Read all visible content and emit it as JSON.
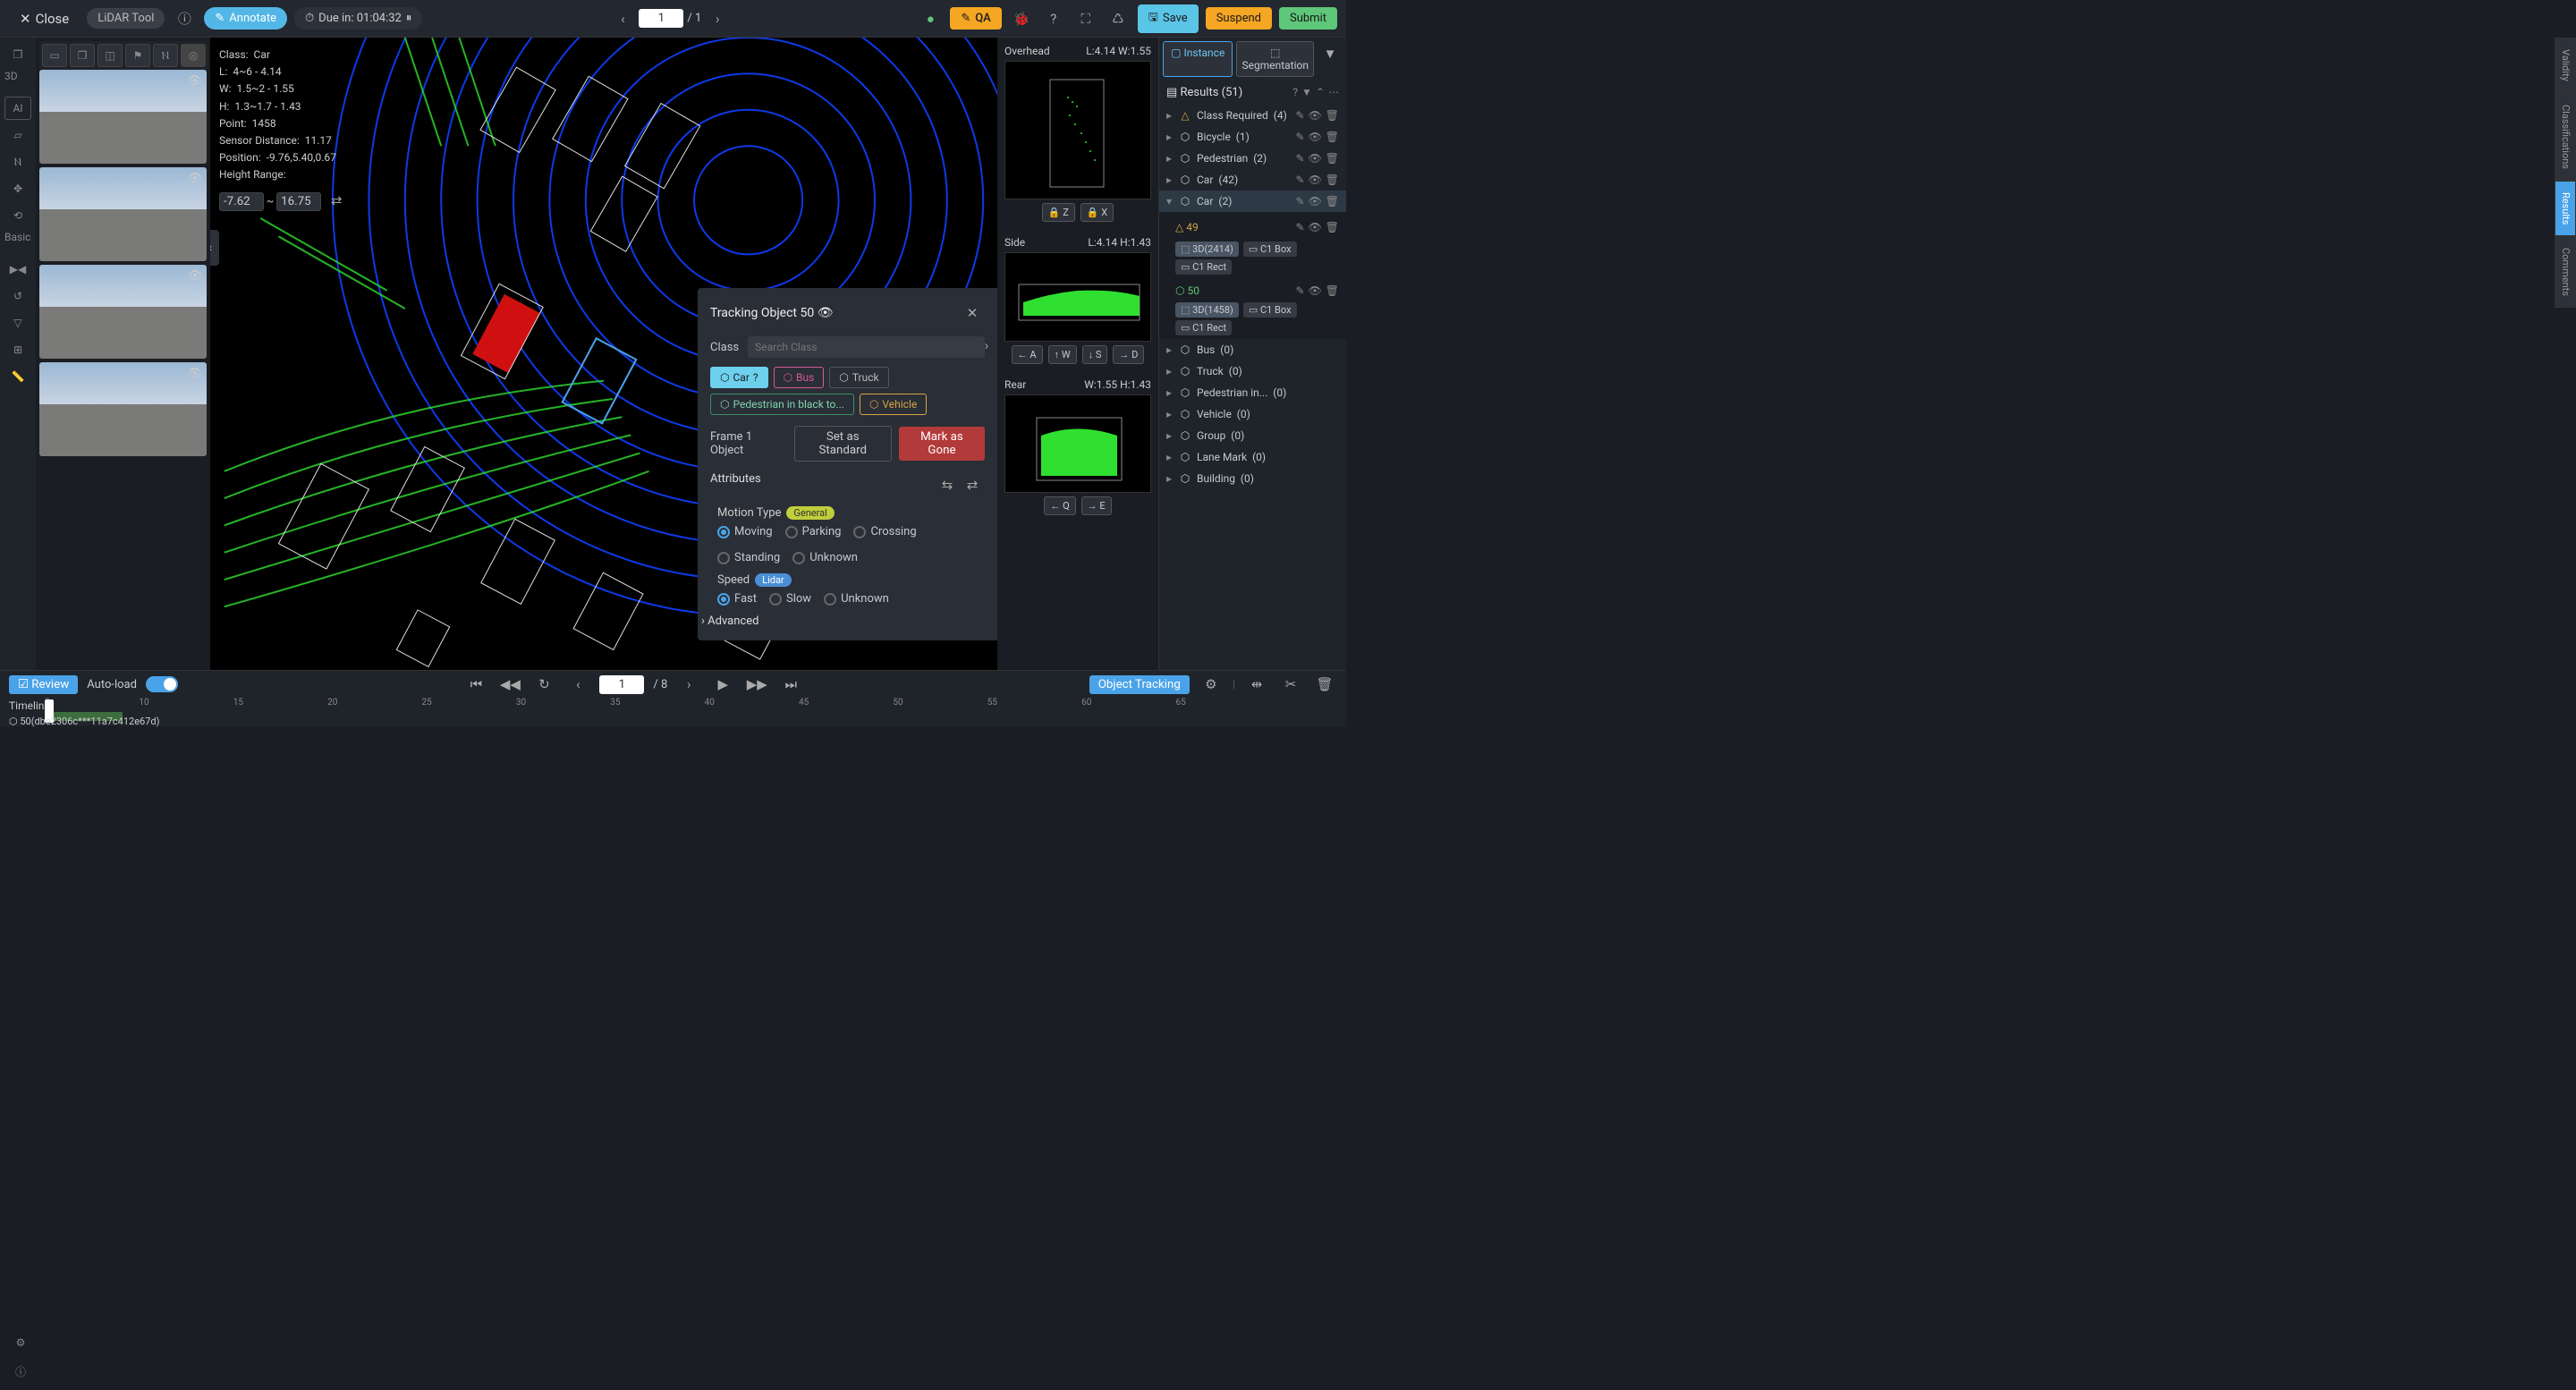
{
  "top": {
    "close": "Close",
    "tool": "LiDAR Tool",
    "annotate": "Annotate",
    "due": "Due in: 01:04:32",
    "frame_cur": "1",
    "frame_tot": "/ 1",
    "qa": "QA",
    "save": "Save",
    "suspend": "Suspend",
    "submit": "Submit"
  },
  "rail": {
    "d3": "3D",
    "ai": "AI",
    "basic": "Basic"
  },
  "info": {
    "class_lbl": "Class:",
    "class_v": "Car",
    "l_lbl": "L:",
    "l_v": "4~6 - 4.14",
    "w_lbl": "W:",
    "w_v": "1.5~2 - 1.55",
    "h_lbl": "H:",
    "h_v": "1.3~1.7 - 1.43",
    "pt_lbl": "Point:",
    "pt_v": "1458",
    "sd_lbl": "Sensor Distance:",
    "sd_v": "11.17",
    "pos_lbl": "Position:",
    "pos_v": "-9.76,5.40,0.67",
    "hr_lbl": "Height Range:",
    "hr_min": "-7.62",
    "hr_sep": "~",
    "hr_max": "16.75"
  },
  "track": {
    "title": "Tracking Object 50",
    "class_lbl": "Class",
    "search_ph": "Search Class",
    "chips": {
      "car": "Car",
      "bus": "Bus",
      "truck": "Truck",
      "ped": "Pedestrian in black to...",
      "veh": "Vehicle"
    },
    "frame_lbl": "Frame 1 Object",
    "std": "Set as Standard",
    "gone": "Mark as Gone",
    "attrs": "Attributes",
    "motion_lbl": "Motion Type",
    "motion_tag": "General",
    "motion": {
      "moving": "Moving",
      "parking": "Parking",
      "crossing": "Crossing",
      "standing": "Standing",
      "unknown": "Unknown"
    },
    "speed_lbl": "Speed",
    "speed_tag": "Lidar",
    "speed": {
      "fast": "Fast",
      "slow": "Slow",
      "unknown": "Unknown"
    },
    "adv": "Advanced"
  },
  "views": {
    "oh": {
      "name": "Overhead",
      "meta": "L:4.14 W:1.55",
      "z": "Z",
      "x": "X"
    },
    "side": {
      "name": "Side",
      "meta": "L:4.14 H:1.43",
      "a": "A",
      "w": "W",
      "s": "S",
      "d": "D"
    },
    "rear": {
      "name": "Rear",
      "meta": "W:1.55 H:1.43",
      "q": "Q",
      "e": "E"
    }
  },
  "rp": {
    "tab_inst": "Instance",
    "tab_seg": "Segmentation",
    "res_hdr": "Results (51)",
    "cls": [
      {
        "name": "Class Required",
        "cnt": "(4)",
        "ic": "△",
        "warn": true
      },
      {
        "name": "Bicycle",
        "cnt": "(1)",
        "ic": "⬡"
      },
      {
        "name": "Pedestrian",
        "cnt": "(2)",
        "ic": "⬡"
      },
      {
        "name": "Car",
        "cnt": "(42)",
        "ic": "⬡"
      }
    ],
    "car_open": {
      "name": "Car",
      "cnt": "(2)",
      "ic": "⬡"
    },
    "obj49": {
      "id": "49",
      "c1": "3D(2414)",
      "c2": "C1 Box",
      "c3": "C1 Rect"
    },
    "obj50": {
      "id": "50",
      "c1": "3D(1458)",
      "c2": "C1 Box",
      "c3": "C1 Rect"
    },
    "more": [
      {
        "name": "Bus",
        "cnt": "(0)"
      },
      {
        "name": "Truck",
        "cnt": "(0)"
      },
      {
        "name": "Pedestrian in...",
        "cnt": "(0)"
      },
      {
        "name": "Vehicle",
        "cnt": "(0)"
      },
      {
        "name": "Group",
        "cnt": "(0)"
      },
      {
        "name": "Lane Mark",
        "cnt": "(0)"
      },
      {
        "name": "Building",
        "cnt": "(0)"
      }
    ]
  },
  "rtabs": {
    "val": "Validity",
    "cla": "Classifications",
    "res": "Results",
    "com": "Comments"
  },
  "bot": {
    "review": "Review",
    "auto": "Auto-load",
    "frame": "1",
    "tot": "/ 8",
    "ot": "Object Tracking",
    "tl": "Timeline",
    "obj": "50(dbe2306c***11a7c412e67d)",
    "ticks": [
      "5",
      "10",
      "15",
      "20",
      "25",
      "30",
      "35",
      "40",
      "45",
      "50",
      "55",
      "60",
      "65"
    ]
  }
}
